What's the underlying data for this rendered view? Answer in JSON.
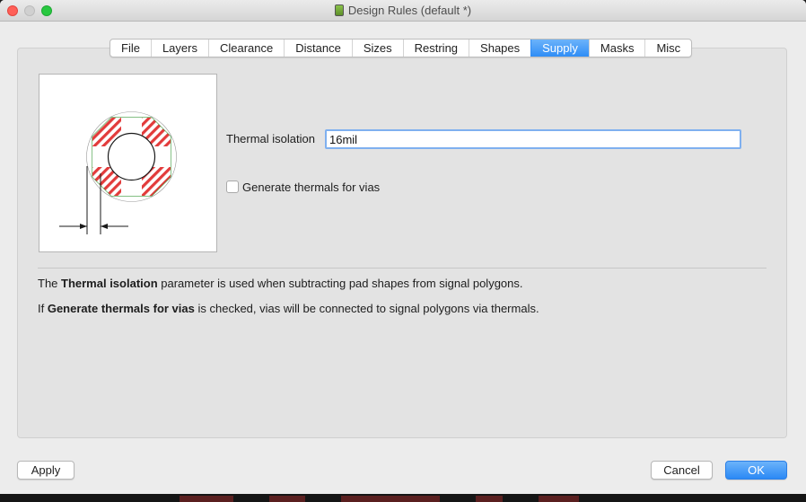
{
  "window": {
    "title": "Design Rules (default *)"
  },
  "tabs": [
    {
      "label": "File",
      "active": false
    },
    {
      "label": "Layers",
      "active": false
    },
    {
      "label": "Clearance",
      "active": false
    },
    {
      "label": "Distance",
      "active": false
    },
    {
      "label": "Sizes",
      "active": false
    },
    {
      "label": "Restring",
      "active": false
    },
    {
      "label": "Shapes",
      "active": false
    },
    {
      "label": "Supply",
      "active": true
    },
    {
      "label": "Masks",
      "active": false
    },
    {
      "label": "Misc",
      "active": false
    }
  ],
  "supply": {
    "thermal_isolation_label": "Thermal isolation",
    "thermal_isolation_value": "16mil",
    "generate_thermals_label": "Generate thermals for vias",
    "generate_thermals_checked": false
  },
  "help": {
    "line1_prefix": "The ",
    "line1_bold": "Thermal isolation",
    "line1_suffix": " parameter is used when subtracting pad shapes from signal polygons.",
    "line2_prefix": "If ",
    "line2_bold": "Generate thermals for vias",
    "line2_suffix": " is checked, vias will be connected to signal polygons via thermals."
  },
  "buttons": {
    "apply": "Apply",
    "cancel": "Cancel",
    "ok": "OK"
  },
  "colors": {
    "accent": "#2f8df6",
    "thermal_hatch": "#e23b3b",
    "pad_outline": "#3a9a3a"
  }
}
